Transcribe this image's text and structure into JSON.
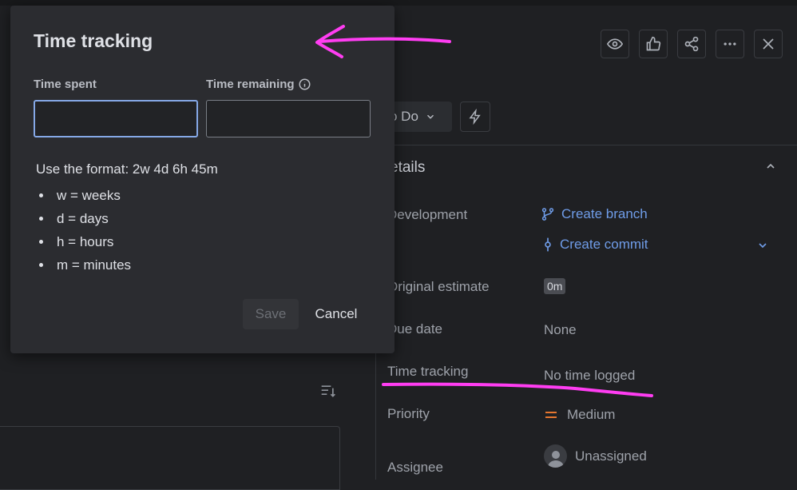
{
  "header": {
    "actions": [
      "watch-icon",
      "like-icon",
      "share-icon",
      "more-icon",
      "close-icon"
    ]
  },
  "status": {
    "label": "o Do"
  },
  "details": {
    "title": "etails",
    "development_label": "Development",
    "create_branch": "Create branch",
    "create_commit": "Create commit",
    "original_estimate_label": "Original estimate",
    "original_estimate_value": "0m",
    "due_date_label": "Due date",
    "due_date_value": "None",
    "time_tracking_label": "Time tracking",
    "time_tracking_value": "No time logged",
    "priority_label": "Priority",
    "priority_value": "Medium",
    "assignee_label": "Assignee",
    "assignee_value": "Unassigned"
  },
  "modal": {
    "title": "Time tracking",
    "time_spent_label": "Time spent",
    "time_spent_value": "",
    "time_remaining_label": "Time remaining",
    "time_remaining_value": "",
    "format_text": "Use the format: 2w 4d 6h 45m",
    "format_items": [
      "w = weeks",
      "d = days",
      "h = hours",
      "m = minutes"
    ],
    "save_label": "Save",
    "cancel_label": "Cancel"
  },
  "colors": {
    "accent_link": "#6f9ce8",
    "annotation": "#ff3df2",
    "priority_medium": "#e5762f"
  }
}
